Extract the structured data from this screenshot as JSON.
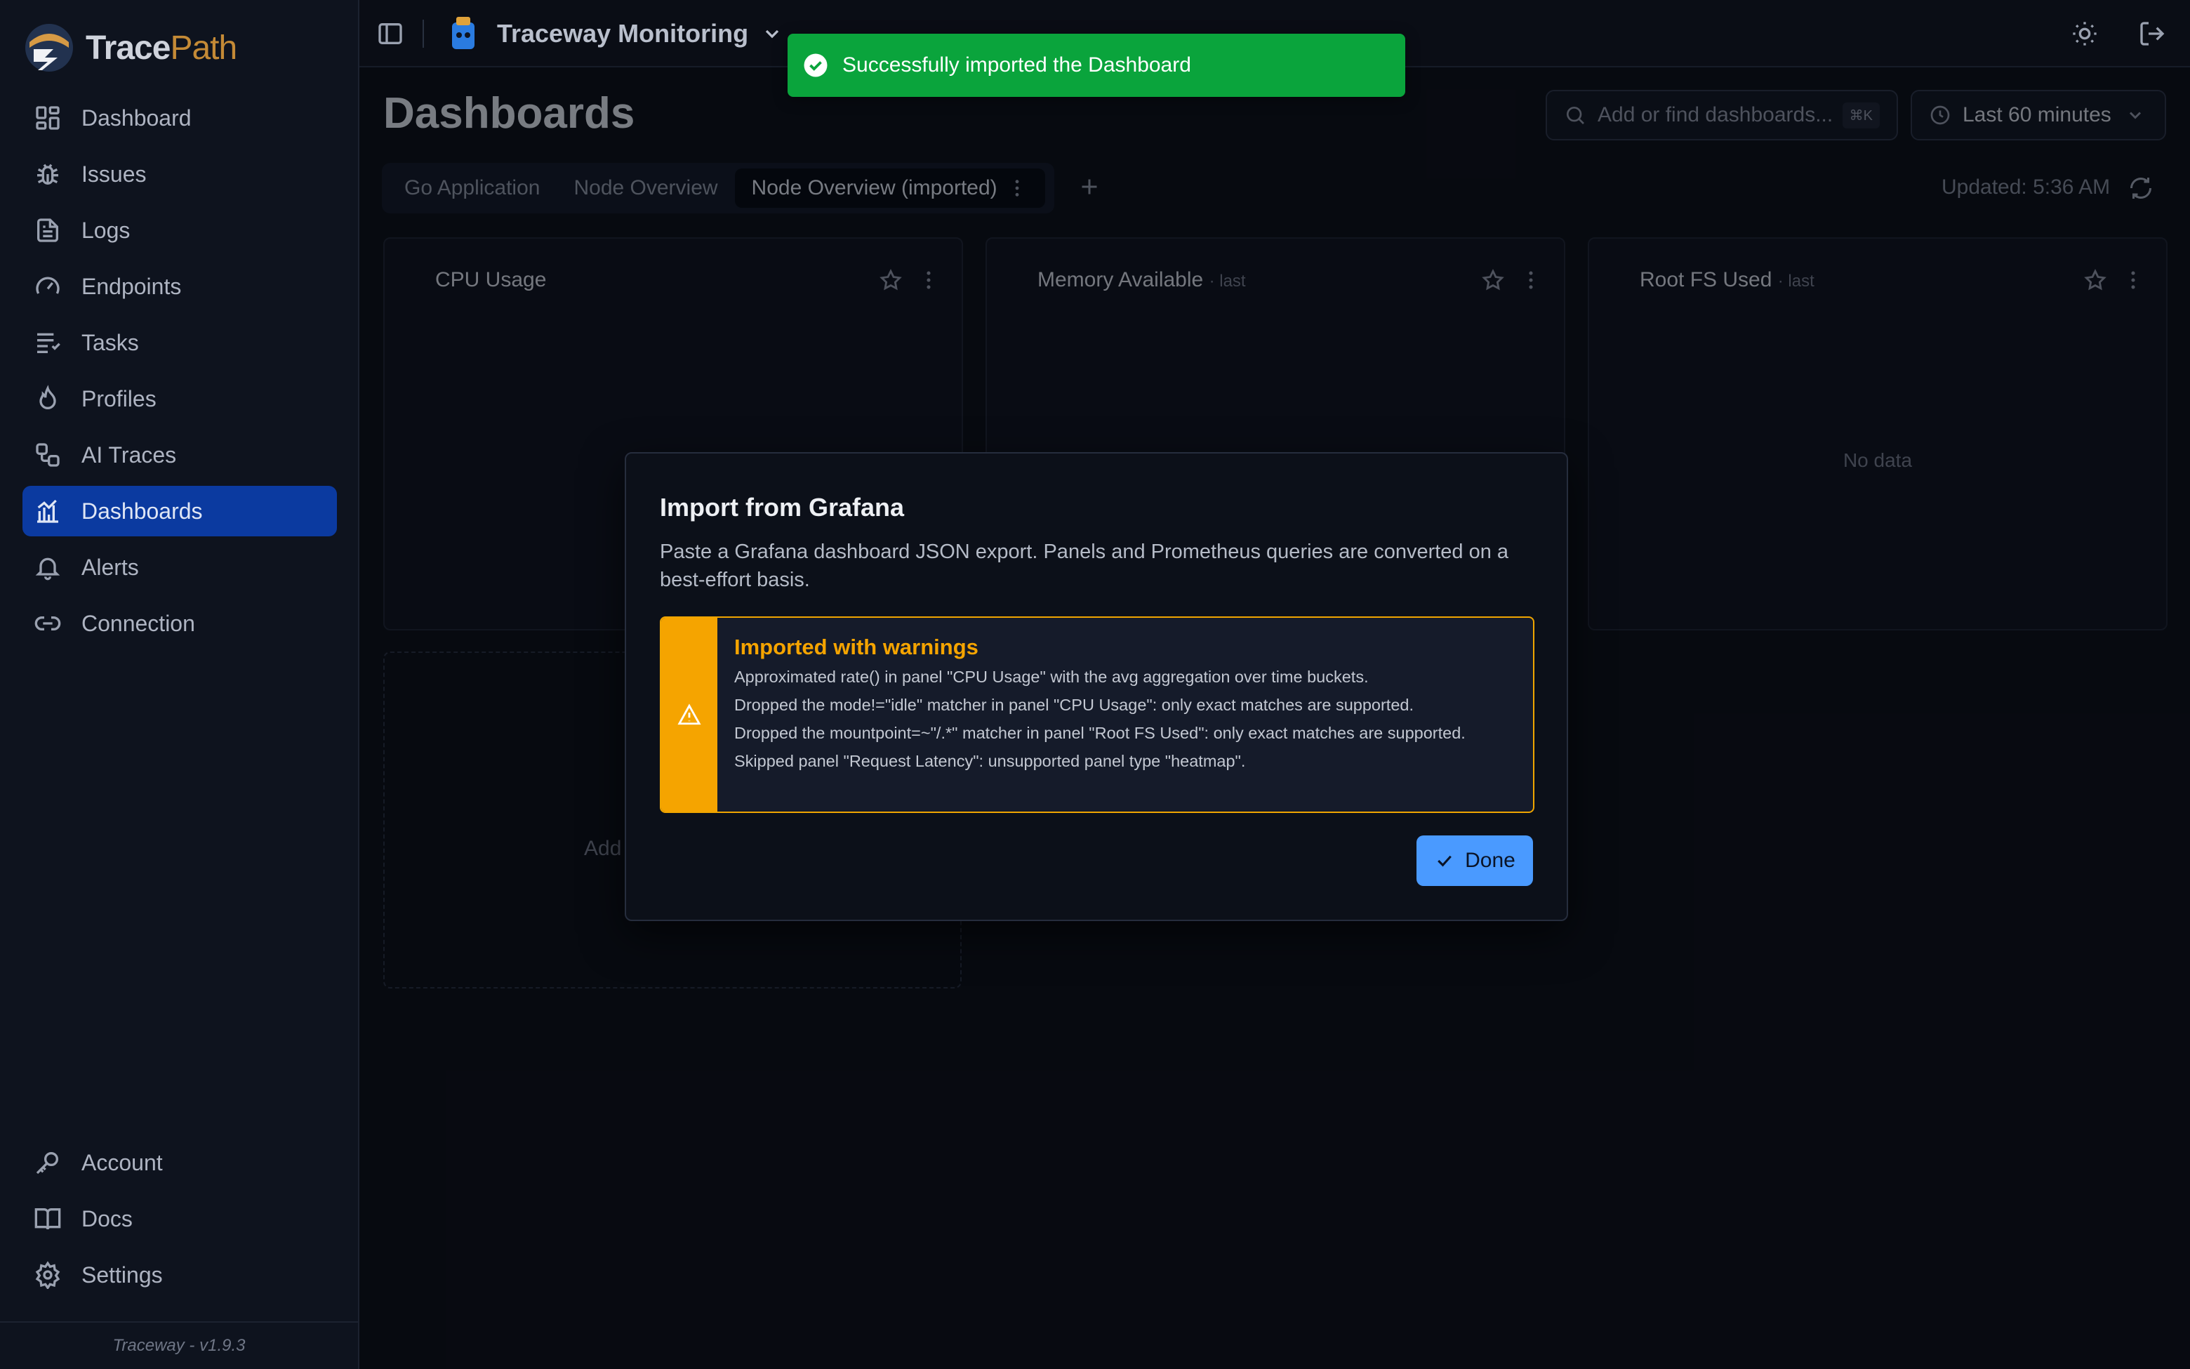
{
  "brand": {
    "name_part1": "Trace",
    "name_part2": "Path"
  },
  "sidebar": {
    "items": [
      {
        "label": "Dashboard",
        "icon": "grid-icon"
      },
      {
        "label": "Issues",
        "icon": "bug-icon"
      },
      {
        "label": "Logs",
        "icon": "file-text-icon"
      },
      {
        "label": "Endpoints",
        "icon": "gauge-icon"
      },
      {
        "label": "Tasks",
        "icon": "list-icon"
      },
      {
        "label": "Profiles",
        "icon": "flame-icon"
      },
      {
        "label": "AI Traces",
        "icon": "workflow-icon"
      },
      {
        "label": "Dashboards",
        "icon": "chart-icon",
        "active": true
      },
      {
        "label": "Alerts",
        "icon": "bell-icon"
      },
      {
        "label": "Connection",
        "icon": "link-icon"
      }
    ],
    "bottom_items": [
      {
        "label": "Account",
        "icon": "key-icon"
      },
      {
        "label": "Docs",
        "icon": "book-icon"
      },
      {
        "label": "Settings",
        "icon": "gear-icon"
      }
    ],
    "footer": "Traceway - v1.9.3",
    "active_color": "#0b3aa0"
  },
  "topbar": {
    "project_name": "Traceway Monitoring"
  },
  "toast": {
    "message": "Successfully imported the Dashboard",
    "color": "#0aa43c"
  },
  "main": {
    "page_title": "Dashboards",
    "search": {
      "placeholder": "Add or find dashboards...",
      "shortcut": "⌘K"
    },
    "time_range": "Last 60 minutes",
    "tabs": [
      {
        "label": "Go Application"
      },
      {
        "label": "Node Overview"
      },
      {
        "label": "Node Overview (imported)",
        "active": true
      }
    ],
    "updated": "Updated: 5:36 AM",
    "panels": [
      {
        "title": "CPU Usage",
        "subtitle": "",
        "empty_text": ""
      },
      {
        "title": "Memory Available",
        "subtitle": "· last",
        "empty_text": ""
      },
      {
        "title": "Root FS Used",
        "subtitle": "· last",
        "empty_text": "No data"
      }
    ],
    "add_panel_label": "Add"
  },
  "modal": {
    "title": "Import from Grafana",
    "description": "Paste a Grafana dashboard JSON export. Panels and Prometheus queries are converted on a best-effort basis.",
    "warning": {
      "title": "Imported with warnings",
      "color": "#f5a400",
      "lines": [
        "Approximated rate() in panel \"CPU Usage\" with the avg aggregation over time buckets.",
        "Dropped the mode!=\"idle\" matcher in panel \"CPU Usage\": only exact matches are supported.",
        "Dropped the mountpoint=~\"/.*\" matcher in panel \"Root FS Used\": only exact matches are supported.",
        "Skipped panel \"Request Latency\": unsupported panel type \"heatmap\"."
      ]
    },
    "done_label": "Done",
    "done_color": "#4a9aff"
  }
}
